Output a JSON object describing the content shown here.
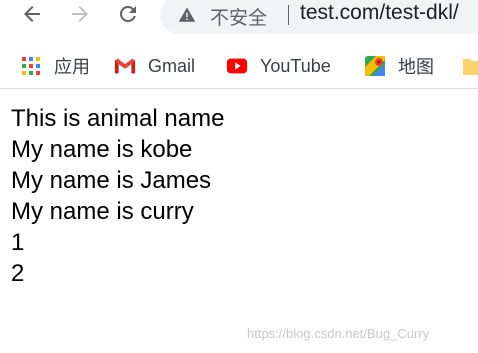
{
  "omnibox": {
    "security_status": "不安全",
    "url": "test.com/test-dkl/"
  },
  "bookmarks": [
    {
      "label": "应用",
      "icon": "apps-grid-icon"
    },
    {
      "label": "Gmail",
      "icon": "gmail-icon"
    },
    {
      "label": "YouTube",
      "icon": "youtube-icon"
    },
    {
      "label": "地图",
      "icon": "maps-icon"
    },
    {
      "label": "",
      "icon": "folder-icon"
    }
  ],
  "page": {
    "lines": [
      "This is animal name",
      "My name is kobe",
      "My name is James",
      "My name is curry",
      "1",
      "2"
    ]
  },
  "watermark": "https://blog.csdn.net/Bug_Curry"
}
